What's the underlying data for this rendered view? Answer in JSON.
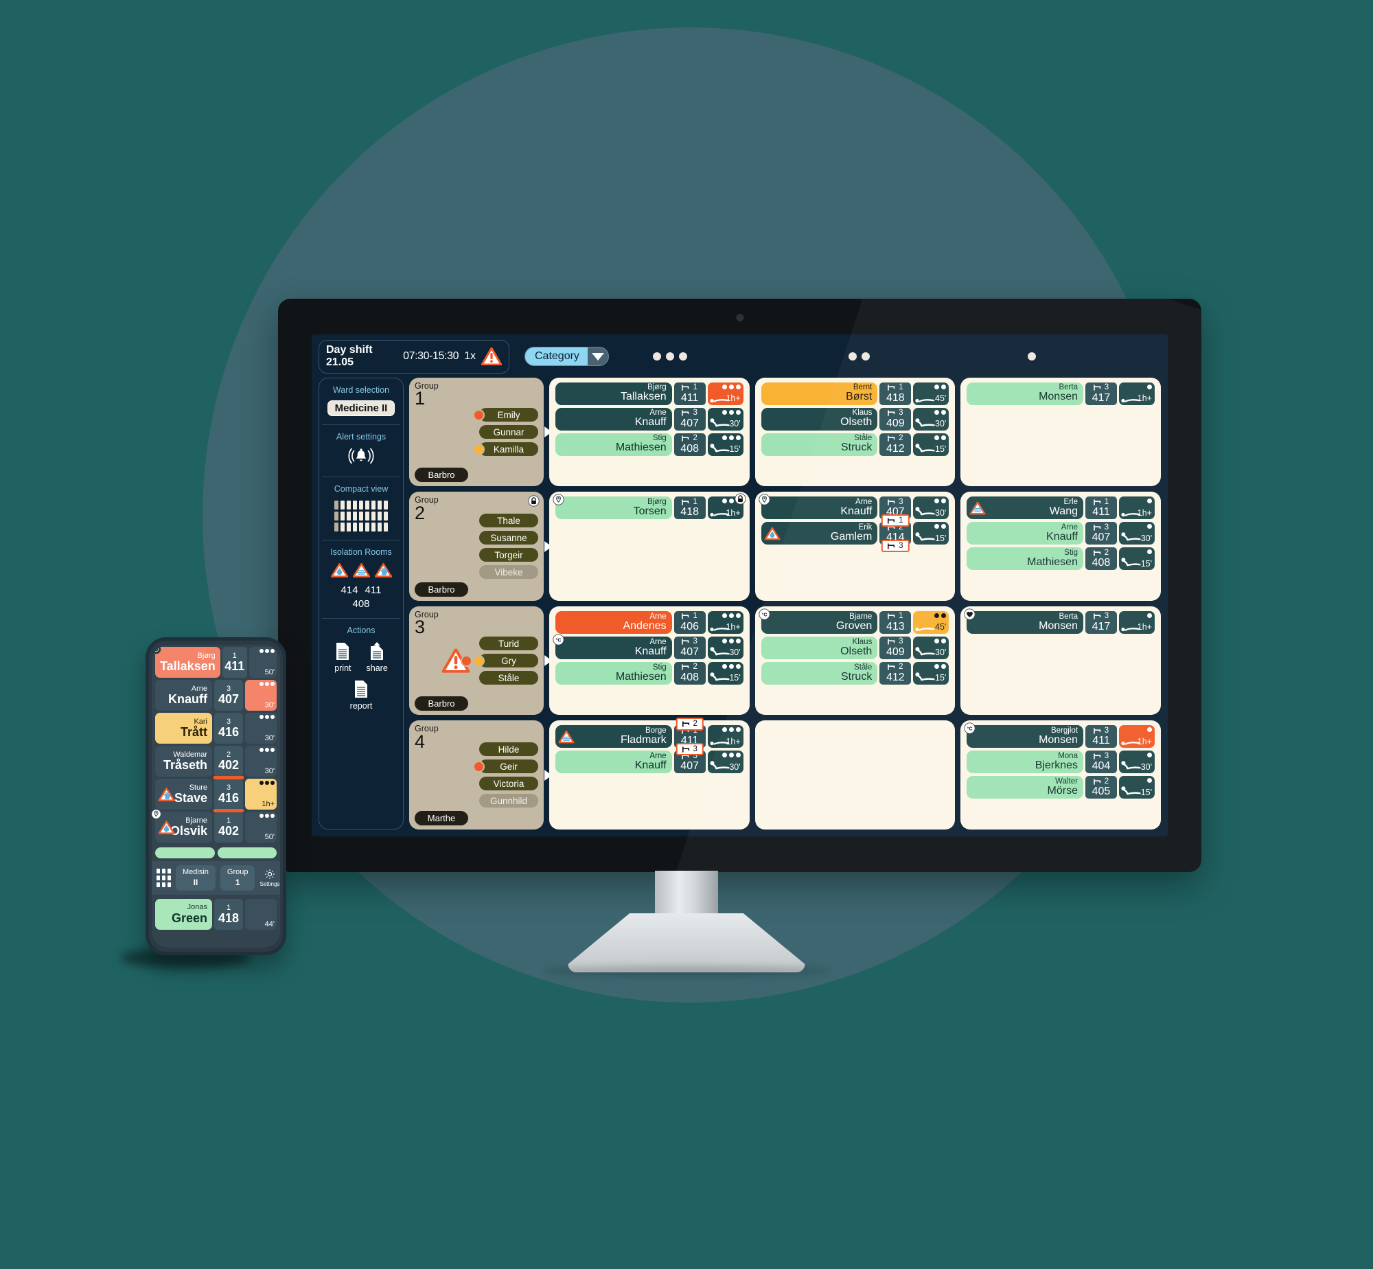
{
  "header": {
    "shift_label": "Day shift",
    "shift_date": "21.05",
    "shift_time": "07:30-15:30",
    "alert_multiplier": "1x",
    "warning_icon": "warning-triangle-icon"
  },
  "topbar": {
    "category_label": "Category",
    "caret_icon": "chevron-down-icon",
    "dot_groups": [
      3,
      2,
      1
    ]
  },
  "sidebar": {
    "ward_selection_label": "Ward selection",
    "ward_value": "Medicine II",
    "alert_settings_label": "Alert settings",
    "bell_icon": "bell-ringing-icon",
    "compact_view_label": "Compact view",
    "isolation_label": "Isolation Rooms",
    "isolation_icons": [
      "droplet-isolation-icon",
      "airborne-isolation-icon",
      "contact-isolation-icon"
    ],
    "isolation_rooms_line1": [
      "414",
      "411"
    ],
    "isolation_rooms_line2": "408",
    "actions_label": "Actions",
    "actions": [
      {
        "label": "print",
        "icon": "print-document-icon"
      },
      {
        "label": "share",
        "icon": "share-document-icon"
      },
      {
        "label": "report",
        "icon": "report-document-icon"
      }
    ]
  },
  "groups": [
    {
      "kicker": "Group",
      "number": "1",
      "lead": "Barbro",
      "locked": false,
      "warning": false,
      "staff": [
        {
          "name": "Emily",
          "dot": "orange",
          "muted": false
        },
        {
          "name": "Gunnar",
          "dot": null,
          "muted": false
        },
        {
          "name": "Kamilla",
          "dot": "amber",
          "muted": false
        }
      ]
    },
    {
      "kicker": "Group",
      "number": "2",
      "lead": "Barbro",
      "locked": true,
      "warning": false,
      "staff": [
        {
          "name": "Thale",
          "dot": null,
          "muted": false
        },
        {
          "name": "Susanne",
          "dot": null,
          "muted": false
        },
        {
          "name": "Torgeir",
          "dot": null,
          "muted": false
        },
        {
          "name": "Vibeke",
          "dot": null,
          "muted": true
        }
      ]
    },
    {
      "kicker": "Group",
      "number": "3",
      "lead": "Barbro",
      "locked": false,
      "warning": true,
      "staff": [
        {
          "name": "Turid",
          "dot": null,
          "muted": false
        },
        {
          "name": "Gry",
          "dot": "amber",
          "dot2": "orange",
          "muted": false
        },
        {
          "name": "Ståle",
          "dot": null,
          "muted": false
        }
      ]
    },
    {
      "kicker": "Group",
      "number": "4",
      "lead": "Marthe",
      "locked": false,
      "warning": false,
      "staff": [
        {
          "name": "Hilde",
          "dot": null,
          "muted": false
        },
        {
          "name": "Geir",
          "dot": "orange",
          "muted": false
        },
        {
          "name": "Victoria",
          "dot": null,
          "muted": false
        },
        {
          "name": "Gunnhild",
          "dot": null,
          "muted": true
        }
      ]
    }
  ],
  "patient_cards": [
    {
      "id": "card-r1c1",
      "dots": 3,
      "empty": false,
      "patients": [
        {
          "first": "Bjørg",
          "last": "Tallaksen",
          "bed": "1",
          "room": "411",
          "time": "1h+",
          "name_color": "dark",
          "stat_color": "orange",
          "badge": null,
          "iso": null,
          "flag_above": null,
          "flag_below": null,
          "posture": "flat"
        },
        {
          "first": "Arne",
          "last": "Knauff",
          "bed": "3",
          "room": "407",
          "time": "30'",
          "name_color": "dark",
          "stat_color": "dark",
          "badge": null,
          "iso": null,
          "flag_above": null,
          "flag_below": null,
          "posture": "sitting"
        },
        {
          "first": "Stig",
          "last": "Mathiesen",
          "bed": "2",
          "room": "408",
          "time": "15'",
          "name_color": "green",
          "stat_color": "dark",
          "badge": null,
          "iso": null,
          "flag_above": null,
          "flag_below": null,
          "posture": "sitting"
        }
      ]
    },
    {
      "id": "card-r1c2",
      "dots": 2,
      "empty": false,
      "patients": [
        {
          "first": "Bernt",
          "last": "Børst",
          "bed": "1",
          "room": "418",
          "time": "45'",
          "name_color": "amber",
          "stat_color": "dark",
          "badge": null,
          "iso": null,
          "flag_above": null,
          "flag_below": null,
          "posture": "flat"
        },
        {
          "first": "Klaus",
          "last": "Olseth",
          "bed": "3",
          "room": "409",
          "time": "30'",
          "name_color": "dark",
          "stat_color": "dark",
          "badge": null,
          "iso": null,
          "flag_above": null,
          "flag_below": null,
          "posture": "sitting"
        },
        {
          "first": "Ståle",
          "last": "Struck",
          "bed": "2",
          "room": "412",
          "time": "15'",
          "name_color": "green",
          "stat_color": "dark",
          "badge": null,
          "iso": null,
          "flag_above": null,
          "flag_below": null,
          "posture": "sitting"
        }
      ]
    },
    {
      "id": "card-r1c3",
      "dots": 1,
      "empty": false,
      "patients": [
        {
          "first": "Berta",
          "last": "Monsen",
          "bed": "3",
          "room": "417",
          "time": "1h+",
          "name_color": "green",
          "stat_color": "dark",
          "badge": null,
          "iso": null,
          "flag_above": null,
          "flag_below": null,
          "posture": "flat"
        }
      ]
    },
    {
      "id": "card-r2c1",
      "dots": 3,
      "empty": false,
      "patients": [
        {
          "first": "Bjørg",
          "last": "Torsen",
          "bed": "1",
          "room": "418",
          "time": "1h+",
          "name_color": "green",
          "stat_color": "dark",
          "badge": "location-pin-icon",
          "badge_right": "lock-icon",
          "iso": null,
          "flag_above": null,
          "flag_below": null,
          "posture": "flat"
        }
      ]
    },
    {
      "id": "card-r2c2",
      "dots": 2,
      "empty": false,
      "patients": [
        {
          "first": "Arne",
          "last": "Knauff",
          "bed": "3",
          "room": "407",
          "time": "30'",
          "name_color": "dark",
          "stat_color": "dark",
          "badge": "location-pin-icon",
          "iso": null,
          "flag_above": null,
          "flag_below": "1",
          "posture": "sitting"
        },
        {
          "first": "Erik",
          "last": "Gamlem",
          "bed": "2",
          "room": "414",
          "time": "15'",
          "name_color": "dark",
          "stat_color": "dark",
          "badge": null,
          "iso": "droplet-isolation-icon",
          "flag_above": null,
          "flag_below": "3",
          "posture": "sitting"
        }
      ]
    },
    {
      "id": "card-r2c3",
      "dots": 1,
      "empty": false,
      "patients": [
        {
          "first": "Erle",
          "last": "Wang",
          "bed": "1",
          "room": "411",
          "time": "1h+",
          "name_color": "dark",
          "stat_color": "dark",
          "badge": null,
          "iso": "airborne-isolation-icon",
          "flag_above": null,
          "flag_below": null,
          "posture": "flat"
        },
        {
          "first": "Arne",
          "last": "Knauff",
          "bed": "3",
          "room": "407",
          "time": "30'",
          "name_color": "green",
          "stat_color": "dark",
          "badge": null,
          "iso": null,
          "flag_above": null,
          "flag_below": null,
          "posture": "sitting"
        },
        {
          "first": "Stig",
          "last": "Mathiesen",
          "bed": "2",
          "room": "408",
          "time": "15'",
          "name_color": "green",
          "stat_color": "dark",
          "badge": null,
          "iso": null,
          "flag_above": null,
          "flag_below": null,
          "posture": "sitting"
        }
      ]
    },
    {
      "id": "card-r3c1",
      "dots": 3,
      "empty": false,
      "patients": [
        {
          "first": "Arne",
          "last": "Andenes",
          "bed": "1",
          "room": "406",
          "time": "1h+",
          "name_color": "orange",
          "stat_color": "dark",
          "badge": null,
          "iso": null,
          "flag_above": null,
          "flag_below": null,
          "posture": "flat"
        },
        {
          "first": "Arne",
          "last": "Knauff",
          "bed": "3",
          "room": "407",
          "time": "30'",
          "name_color": "dark",
          "stat_color": "dark",
          "badge": "temperature-icon",
          "iso": null,
          "flag_above": null,
          "flag_below": null,
          "posture": "sitting"
        },
        {
          "first": "Stig",
          "last": "Mathiesen",
          "bed": "2",
          "room": "408",
          "time": "15'",
          "name_color": "green",
          "stat_color": "dark",
          "badge": null,
          "iso": null,
          "flag_above": null,
          "flag_below": null,
          "posture": "sitting"
        }
      ]
    },
    {
      "id": "card-r3c2",
      "dots": 2,
      "empty": false,
      "patients": [
        {
          "first": "Bjarne",
          "last": "Groven",
          "bed": "1",
          "room": "413",
          "time": "45'",
          "name_color": "dark",
          "stat_color": "amber",
          "badge": "temperature-icon",
          "iso": null,
          "flag_above": null,
          "flag_below": null,
          "posture": "flat"
        },
        {
          "first": "Klaus",
          "last": "Olseth",
          "bed": "3",
          "room": "409",
          "time": "30'",
          "name_color": "green",
          "stat_color": "dark",
          "badge": null,
          "iso": null,
          "flag_above": null,
          "flag_below": null,
          "posture": "sitting"
        },
        {
          "first": "Ståle",
          "last": "Struck",
          "bed": "2",
          "room": "412",
          "time": "15'",
          "name_color": "green",
          "stat_color": "dark",
          "badge": null,
          "iso": null,
          "flag_above": null,
          "flag_below": null,
          "posture": "sitting"
        }
      ]
    },
    {
      "id": "card-r3c3",
      "dots": 1,
      "empty": false,
      "patients": [
        {
          "first": "Berta",
          "last": "Monsen",
          "bed": "3",
          "room": "417",
          "time": "1h+",
          "name_color": "dark",
          "stat_color": "dark",
          "badge": "heart-icon",
          "iso": null,
          "flag_above": null,
          "flag_below": null,
          "posture": "flat"
        }
      ]
    },
    {
      "id": "card-r4c1",
      "dots": 3,
      "empty": false,
      "patients": [
        {
          "first": "Borge",
          "last": "Fladmark",
          "bed": "1",
          "room": "411",
          "time": "1h+",
          "name_color": "dark",
          "stat_color": "dark",
          "badge": null,
          "iso": "airborne-isolation-icon",
          "flag_above": "2",
          "flag_below": "3",
          "posture": "flat"
        },
        {
          "first": "Arne",
          "last": "Knauff",
          "bed": "3",
          "room": "407",
          "time": "30'",
          "name_color": "green",
          "stat_color": "dark",
          "badge": null,
          "iso": null,
          "flag_above": null,
          "flag_below": null,
          "posture": "sitting"
        }
      ]
    },
    {
      "id": "card-r4c2",
      "dots": 2,
      "empty": true,
      "patients": []
    },
    {
      "id": "card-r4c3",
      "dots": 1,
      "empty": false,
      "patients": [
        {
          "first": "Bergjlot",
          "last": "Monsen",
          "bed": "3",
          "room": "411",
          "time": "1h+",
          "name_color": "dark",
          "stat_color": "orange",
          "badge": "temperature-icon",
          "iso": null,
          "flag_above": null,
          "flag_below": null,
          "posture": "flat"
        },
        {
          "first": "Mona",
          "last": "Bjerknes",
          "bed": "3",
          "room": "404",
          "time": "30'",
          "name_color": "green",
          "stat_color": "dark",
          "badge": null,
          "iso": null,
          "flag_above": null,
          "flag_below": null,
          "posture": "sitting"
        },
        {
          "first": "Walter",
          "last": "Mörse",
          "bed": "2",
          "room": "405",
          "time": "15'",
          "name_color": "green",
          "stat_color": "dark",
          "badge": null,
          "iso": null,
          "flag_above": null,
          "flag_below": null,
          "posture": "sitting"
        }
      ]
    }
  ],
  "phone": {
    "rows": [
      {
        "first": "Bjørg",
        "last": "Tallaksen",
        "bed": "1",
        "room": "411",
        "time": "50'",
        "name_color": "salmon",
        "stat_color": "dark",
        "badge": "clock-icon",
        "iso": null,
        "flag_up": false,
        "flag_dn": false
      },
      {
        "first": "Arne",
        "last": "Knauff",
        "bed": "3",
        "room": "407",
        "time": "30'",
        "name_color": "dark",
        "stat_color": "salmon",
        "badge": null,
        "iso": null,
        "flag_up": false,
        "flag_dn": false,
        "prefix": "×"
      },
      {
        "first": "Kari",
        "last": "Trått",
        "bed": "3",
        "room": "416",
        "time": "30'",
        "name_color": "amber",
        "stat_color": "dark",
        "badge": null,
        "iso": null,
        "flag_up": false,
        "flag_dn": false
      },
      {
        "first": "Waldemar",
        "last": "Tråseth",
        "bed": "2",
        "room": "402",
        "time": "30'",
        "name_color": "dark",
        "stat_color": "dark",
        "badge": null,
        "iso": null,
        "flag_up": false,
        "flag_dn": true
      },
      {
        "first": "Sture",
        "last": "Stave",
        "bed": "3",
        "room": "416",
        "time": "1h+",
        "name_color": "dark",
        "stat_color": "amber",
        "badge": null,
        "iso": "contact-isolation-icon",
        "flag_up": true,
        "flag_dn": true
      },
      {
        "first": "Bjarne",
        "last": "Olsvik",
        "bed": "1",
        "room": "402",
        "time": "50'",
        "name_color": "dark",
        "stat_color": "dark",
        "badge": "location-pin-icon",
        "iso": "droplet-isolation-icon",
        "flag_up": false,
        "flag_dn": false
      }
    ],
    "nav": {
      "ward_kicker": "Medisin",
      "ward_value": "II",
      "group_kicker": "Group",
      "group_value": "1",
      "settings_label": "Settings",
      "settings_icon": "gear-icon",
      "apps_icon": "apps-grid-icon"
    },
    "bottom_row": {
      "first": "Jonas",
      "last": "Green",
      "bed": "1",
      "room": "418",
      "time": "44'",
      "name_color": "greenm"
    }
  },
  "colors": {
    "accent_orange": "#f15a29",
    "accent_amber": "#f9b233",
    "accent_green": "#9fe3b4",
    "card_bg": "#fbf6e6",
    "dark_teal": "#22494b",
    "screen_bg": "#0d2235",
    "group_bg": "#c3b9a4",
    "category_blue": "#8fd6f2"
  }
}
